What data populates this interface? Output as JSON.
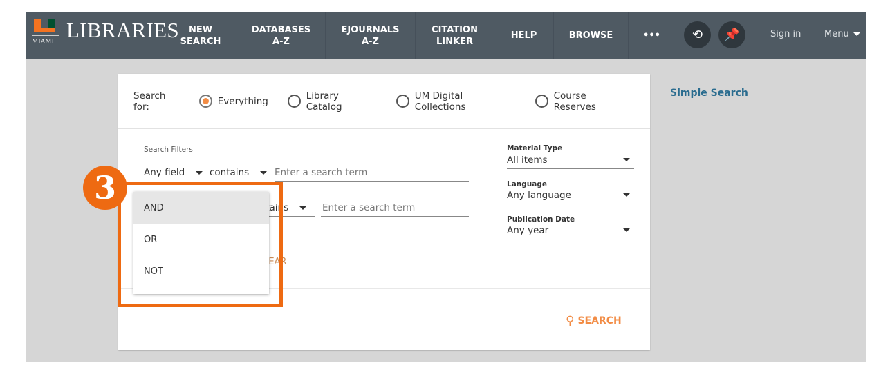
{
  "nav": {
    "logo_text": "MIAMI",
    "brand": "LIBRARIES",
    "items": [
      "NEW\nSEARCH",
      "DATABASES\nA-Z",
      "EJOURNALS\nA-Z",
      "CITATION\nLINKER",
      "HELP",
      "BROWSE"
    ],
    "more": "•••",
    "sign_in": "Sign in",
    "menu": "Menu"
  },
  "search": {
    "search_for_label": "Search for:",
    "scopes": [
      {
        "label": "Everything",
        "selected": true
      },
      {
        "label": "Library Catalog",
        "selected": false
      },
      {
        "label": "UM Digital Collections",
        "selected": false
      },
      {
        "label": "Course Reserves",
        "selected": false
      }
    ],
    "filters_label": "Search Filters",
    "row1": {
      "field": "Any field",
      "operator": "contains",
      "placeholder": "Enter a search term"
    },
    "row2": {
      "operator": "contains",
      "placeholder": "Enter a search term"
    },
    "clear": "CLEAR",
    "material_type": {
      "label": "Material Type",
      "value": "All items"
    },
    "language": {
      "label": "Language",
      "value": "Any language"
    },
    "publication_date": {
      "label": "Publication Date",
      "value": "Any year"
    },
    "search_button": "SEARCH",
    "simple_search": "Simple Search"
  },
  "boolean_dropdown": {
    "options": [
      "AND",
      "OR",
      "NOT"
    ],
    "highlighted": "AND"
  },
  "annotation": {
    "step": "3",
    "color": "#ee6a12"
  },
  "colors": {
    "nav": "#4f5a63",
    "accent": "#f28c45",
    "link": "#2a6c8f"
  }
}
